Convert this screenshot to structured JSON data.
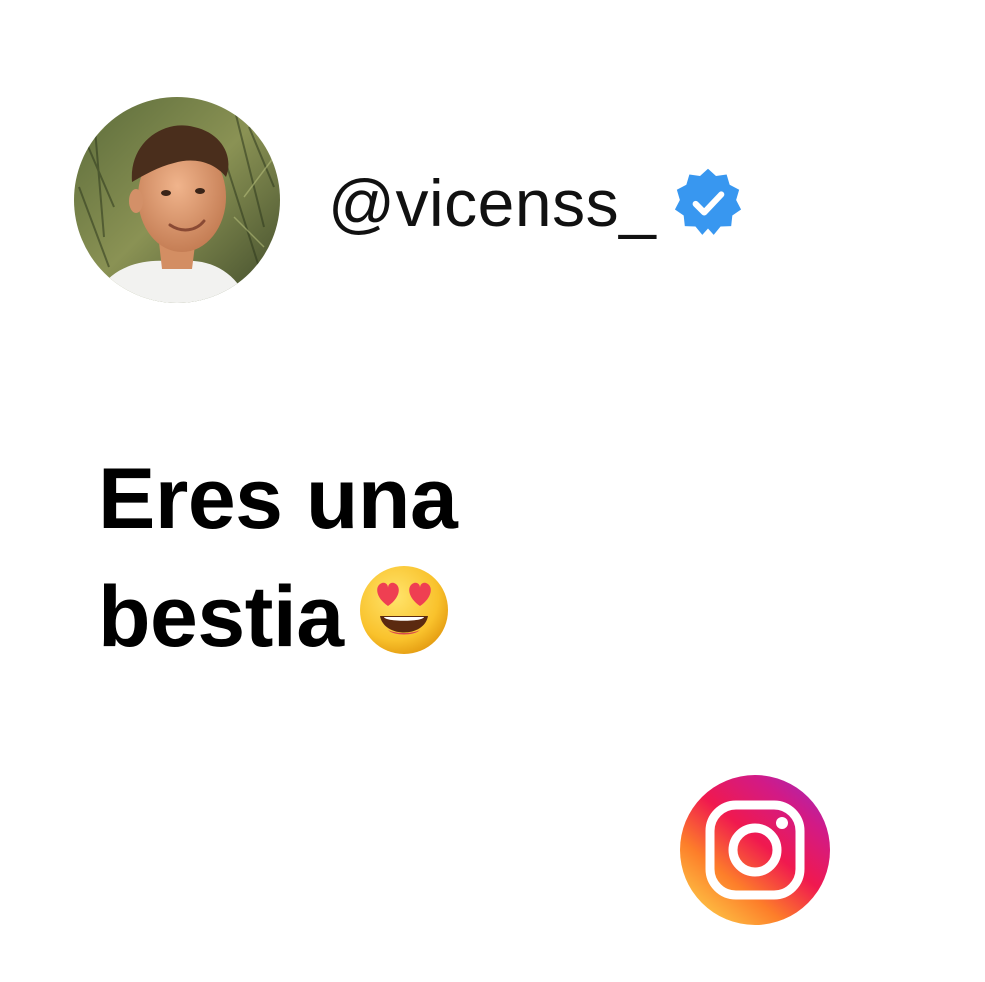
{
  "profile": {
    "handle": "@vicenss_",
    "verified": true,
    "avatar_icon": "profile-photo-avatar",
    "verified_icon": "verified-badge-icon"
  },
  "message": {
    "line1": "Eres una",
    "line2": "bestia",
    "emoji_icon": "heart-eyes-emoji-icon"
  },
  "branding": {
    "logo_icon": "instagram-logo-icon"
  },
  "colors": {
    "background": "#ffffff",
    "text": "#000000",
    "verified_blue": "#3897f0"
  }
}
